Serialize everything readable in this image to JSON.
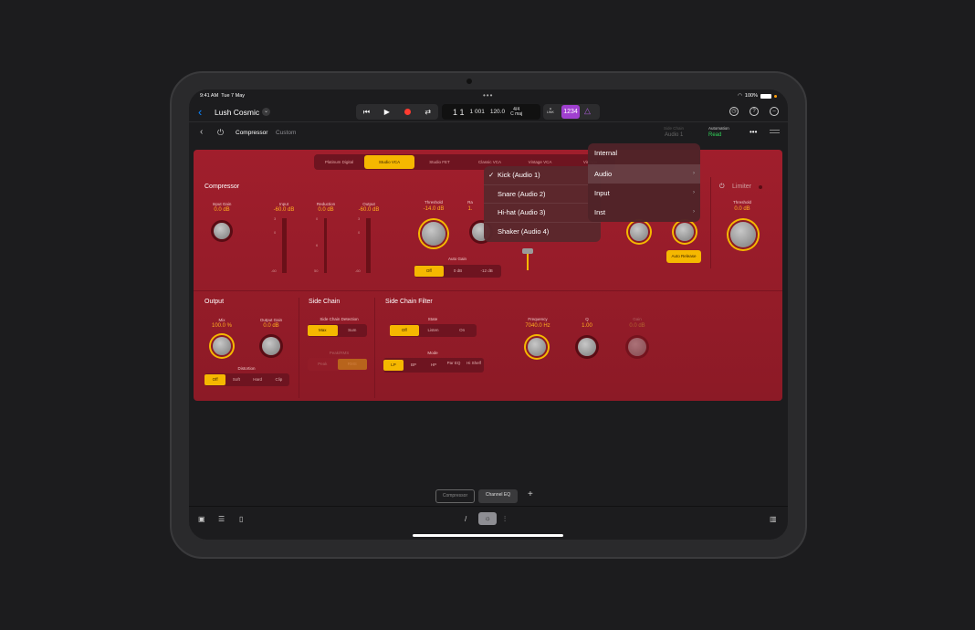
{
  "status_bar": {
    "time": "9:41 AM",
    "date": "Tue 7 May",
    "battery": "100%"
  },
  "toolbar": {
    "project_name": "Lush Cosmic",
    "lcd": {
      "bars": "1",
      "beats": "1",
      "div_tick": "1 001",
      "tempo": "120.0",
      "signature": "4/4",
      "key": "C maj"
    },
    "link_label": "LINK",
    "count_in": "1234"
  },
  "plugin_header": {
    "plugin_name": "Compressor",
    "preset": "Custom",
    "side_chain_label": "Side Chain",
    "side_chain_value": "Audio 1",
    "automation_label": "Automation",
    "automation_value": "Read"
  },
  "models": [
    "Platinum Digital",
    "Studio VCA",
    "Studio FET",
    "Classic VCA",
    "Vintage VCA",
    "Vintage"
  ],
  "active_model": "Studio VCA",
  "compressor": {
    "title": "Compressor",
    "input_gain": {
      "label": "Input Gain",
      "value": "0.0 dB"
    },
    "input_meter": {
      "label": "Input",
      "value": "-60.0 dB",
      "ticks": [
        "3",
        "0",
        "-",
        "-",
        "-60"
      ]
    },
    "reduction_meter": {
      "label": "Reduction",
      "value": "0.0 dB",
      "ticks": [
        "0",
        "-",
        "6",
        "-",
        "50"
      ]
    },
    "output_meter": {
      "label": "Output",
      "value": "-60.0 dB",
      "ticks": [
        "3",
        "0",
        "-",
        "-",
        "-60"
      ]
    },
    "threshold": {
      "label": "Threshold",
      "value": "-14.0 dB"
    },
    "ratio": {
      "label": "Ra",
      "value": "1."
    },
    "auto_gain": {
      "label": "Auto Gain",
      "options": [
        "Off",
        "0 dB",
        "-12 dB"
      ],
      "selected": "Off"
    },
    "auto_release": "Auto Release"
  },
  "limiter": {
    "title": "Limiter",
    "threshold": {
      "label": "Threshold",
      "value": "0.0 dB"
    }
  },
  "output": {
    "title": "Output",
    "mix": {
      "label": "Mix",
      "value": "100.0 %"
    },
    "output_gain": {
      "label": "Output Gain",
      "value": "0.0 dB"
    },
    "distortion": {
      "label": "Distortion",
      "options": [
        "Off",
        "Soft",
        "Hard",
        "Clip"
      ],
      "selected": "Off"
    }
  },
  "side_chain": {
    "title": "Side Chain",
    "detection": {
      "label": "Side Chain Detection",
      "options": [
        "Max",
        "Sum"
      ],
      "selected": "Max"
    },
    "peak_rms": {
      "label": "Peak/RMS",
      "options": [
        "Peak",
        "RMS"
      ],
      "selected": "RMS"
    }
  },
  "side_chain_filter": {
    "title": "Side Chain Filter",
    "state": {
      "label": "State",
      "options": [
        "Off",
        "Listen",
        "On"
      ],
      "selected": "Off"
    },
    "mode": {
      "label": "Mode",
      "options": [
        "LP",
        "BP",
        "HP",
        "Par EQ",
        "Hi Shelf"
      ],
      "selected": "LP"
    },
    "frequency": {
      "label": "Frequency",
      "value": "7040.0 Hz"
    },
    "q": {
      "label": "Q",
      "value": "1.00"
    },
    "gain": {
      "label": "Gain",
      "value": "0.0 dB"
    }
  },
  "side_chain_menu": {
    "items": [
      "Kick (Audio 1)",
      "Snare (Audio 2)",
      "Hi-hat (Audio 3)",
      "Shaker (Audio 4)"
    ],
    "checked": "Kick (Audio 1)"
  },
  "source_menu": {
    "items": [
      "Internal",
      "Audio",
      "Input",
      "Inst"
    ],
    "highlighted": "Audio"
  },
  "plugin_slots": [
    "Compressor",
    "Channel EQ"
  ],
  "add_slot": "+"
}
